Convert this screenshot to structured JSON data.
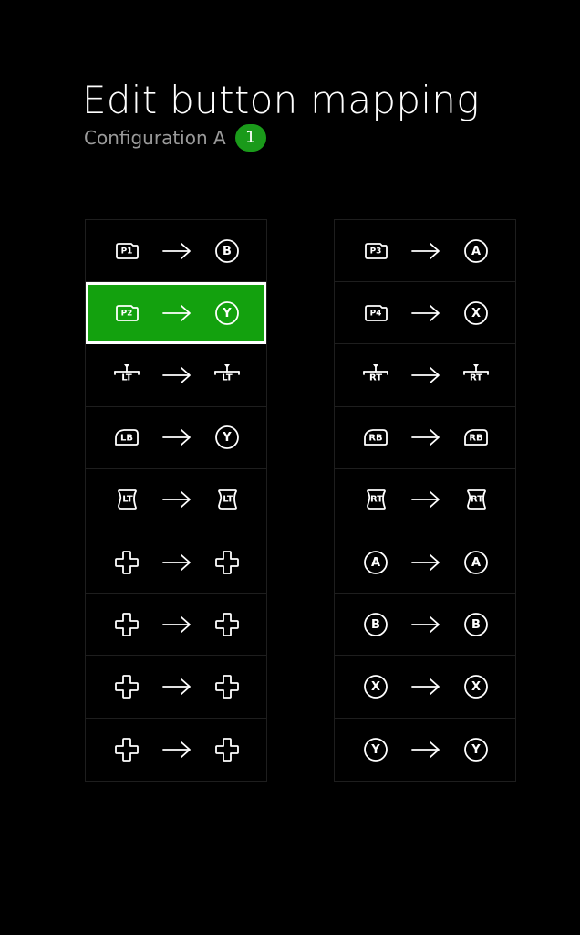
{
  "header": {
    "title": "Edit button mapping",
    "subtitle": "Configuration A",
    "badge": "1"
  },
  "mappings_left": [
    {
      "from": {
        "icon": "paddle-icon",
        "label": "P1"
      },
      "to": {
        "icon": "circle-icon",
        "label": "B"
      },
      "selected": false
    },
    {
      "from": {
        "icon": "paddle-icon",
        "label": "P2"
      },
      "to": {
        "icon": "circle-icon",
        "label": "Y"
      },
      "selected": true
    },
    {
      "from": {
        "icon": "trigger-lock-icon",
        "label": "LT"
      },
      "to": {
        "icon": "trigger-lock-icon",
        "label": "LT"
      },
      "selected": false
    },
    {
      "from": {
        "icon": "bumper-icon",
        "label": "LB"
      },
      "to": {
        "icon": "circle-icon",
        "label": "Y"
      },
      "selected": false
    },
    {
      "from": {
        "icon": "trigger-icon",
        "label": "LT"
      },
      "to": {
        "icon": "trigger-icon",
        "label": "LT"
      },
      "selected": false
    },
    {
      "from": {
        "icon": "dpad-icon",
        "label": ""
      },
      "to": {
        "icon": "dpad-icon",
        "label": ""
      },
      "selected": false
    },
    {
      "from": {
        "icon": "dpad-icon",
        "label": ""
      },
      "to": {
        "icon": "dpad-icon",
        "label": ""
      },
      "selected": false
    },
    {
      "from": {
        "icon": "dpad-icon",
        "label": ""
      },
      "to": {
        "icon": "dpad-icon",
        "label": ""
      },
      "selected": false
    },
    {
      "from": {
        "icon": "dpad-icon",
        "label": ""
      },
      "to": {
        "icon": "dpad-icon",
        "label": ""
      },
      "selected": false
    }
  ],
  "mappings_right": [
    {
      "from": {
        "icon": "paddle-icon",
        "label": "P3"
      },
      "to": {
        "icon": "circle-icon",
        "label": "A"
      },
      "selected": false
    },
    {
      "from": {
        "icon": "paddle-icon",
        "label": "P4"
      },
      "to": {
        "icon": "circle-icon",
        "label": "X"
      },
      "selected": false
    },
    {
      "from": {
        "icon": "trigger-lock-icon",
        "label": "RT"
      },
      "to": {
        "icon": "trigger-lock-icon",
        "label": "RT"
      },
      "selected": false
    },
    {
      "from": {
        "icon": "bumper-icon",
        "label": "RB"
      },
      "to": {
        "icon": "bumper-icon",
        "label": "RB"
      },
      "selected": false
    },
    {
      "from": {
        "icon": "trigger-icon",
        "label": "RT"
      },
      "to": {
        "icon": "trigger-icon",
        "label": "RT"
      },
      "selected": false
    },
    {
      "from": {
        "icon": "circle-icon",
        "label": "A"
      },
      "to": {
        "icon": "circle-icon",
        "label": "A"
      },
      "selected": false
    },
    {
      "from": {
        "icon": "circle-icon",
        "label": "B"
      },
      "to": {
        "icon": "circle-icon",
        "label": "B"
      },
      "selected": false
    },
    {
      "from": {
        "icon": "circle-icon",
        "label": "X"
      },
      "to": {
        "icon": "circle-icon",
        "label": "X"
      },
      "selected": false
    },
    {
      "from": {
        "icon": "circle-icon",
        "label": "Y"
      },
      "to": {
        "icon": "circle-icon",
        "label": "Y"
      },
      "selected": false
    }
  ],
  "colors": {
    "background": "#000000",
    "accent": "#13a10e",
    "badge": "#1a9a1a",
    "subtitle": "#9a9a9a",
    "divider": "#1e1e1e"
  }
}
